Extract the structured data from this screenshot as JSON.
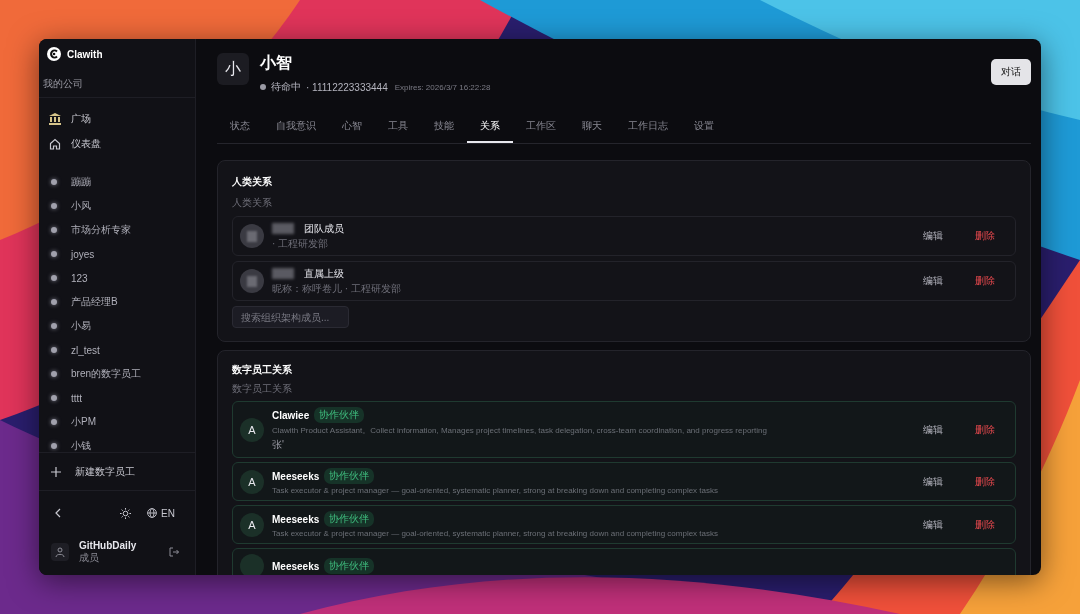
{
  "app": {
    "name": "Clawith"
  },
  "sidebar": {
    "company": "我的公司",
    "nav": [
      {
        "kind": "bank",
        "label": "广场"
      },
      {
        "kind": "home",
        "label": "仪表盘"
      }
    ],
    "agents": [
      {
        "name": "蹦蹦"
      },
      {
        "name": "小风"
      },
      {
        "name": "市场分析专家"
      },
      {
        "name": "joyes"
      },
      {
        "name": "123"
      },
      {
        "name": "产品经理B"
      },
      {
        "name": "小易"
      },
      {
        "name": "zl_test"
      },
      {
        "name": "bren的数字员工"
      },
      {
        "name": "tttt"
      },
      {
        "name": "小PM"
      },
      {
        "name": "小钱"
      }
    ],
    "new_agent": "新建数字员工",
    "language": "EN",
    "user": {
      "name": "GitHubDaily",
      "role": "成员"
    }
  },
  "agent": {
    "avatar": "小",
    "name": "小智",
    "status": "待命中",
    "id": "· 11112223333444",
    "expires": "Expires: 2026/3/7 16:22:28"
  },
  "chat_button": "对话",
  "tabs": [
    {
      "label": "状态",
      "selected": false
    },
    {
      "label": "自我意识",
      "selected": false
    },
    {
      "label": "心智",
      "selected": false
    },
    {
      "label": "工具",
      "selected": false
    },
    {
      "label": "技能",
      "selected": false
    },
    {
      "label": "关系",
      "selected": true
    },
    {
      "label": "工作区",
      "selected": false
    },
    {
      "label": "聊天",
      "selected": false
    },
    {
      "label": "工作日志",
      "selected": false
    },
    {
      "label": "设置",
      "selected": false
    }
  ],
  "human_relations": {
    "title": "人类关系",
    "subtitle": "人类关系",
    "rows": [
      {
        "role": "团队成员",
        "detail": "· 工程研发部",
        "edit": "编辑",
        "delete": "删除"
      },
      {
        "role": "直属上级",
        "detail": "昵称：称呼卷儿 · 工程研发部",
        "edit": "编辑",
        "delete": "删除"
      }
    ],
    "search": {
      "placeholder": "搜索组织架构成员..."
    }
  },
  "agent_relations": {
    "title": "数字员工关系",
    "subtitle": "数字员工关系",
    "rows": [
      {
        "avatar": "A",
        "name": "Clawiee",
        "tag": "协作伙伴",
        "description": "Clawith Product Assistant。Collect information, Manages project timelines, task delegation, cross-team coordination, and progress reporting",
        "note": "张'",
        "edit": "编辑",
        "delete": "删除"
      },
      {
        "avatar": "A",
        "name": "Meeseeks",
        "tag": "协作伙伴",
        "description": "Task executor & project manager — goal-oriented, systematic planner, strong at breaking down and completing complex tasks",
        "edit": "编辑",
        "delete": "删除"
      },
      {
        "avatar": "A",
        "name": "Meeseeks",
        "tag": "协作伙伴",
        "description": "Task executor & project manager — goal-oriented, systematic planner, strong at breaking down and completing complex tasks",
        "edit": "编辑",
        "delete": "删除"
      },
      {
        "name": "Meeseeks",
        "tag": "协作伙伴"
      }
    ]
  }
}
